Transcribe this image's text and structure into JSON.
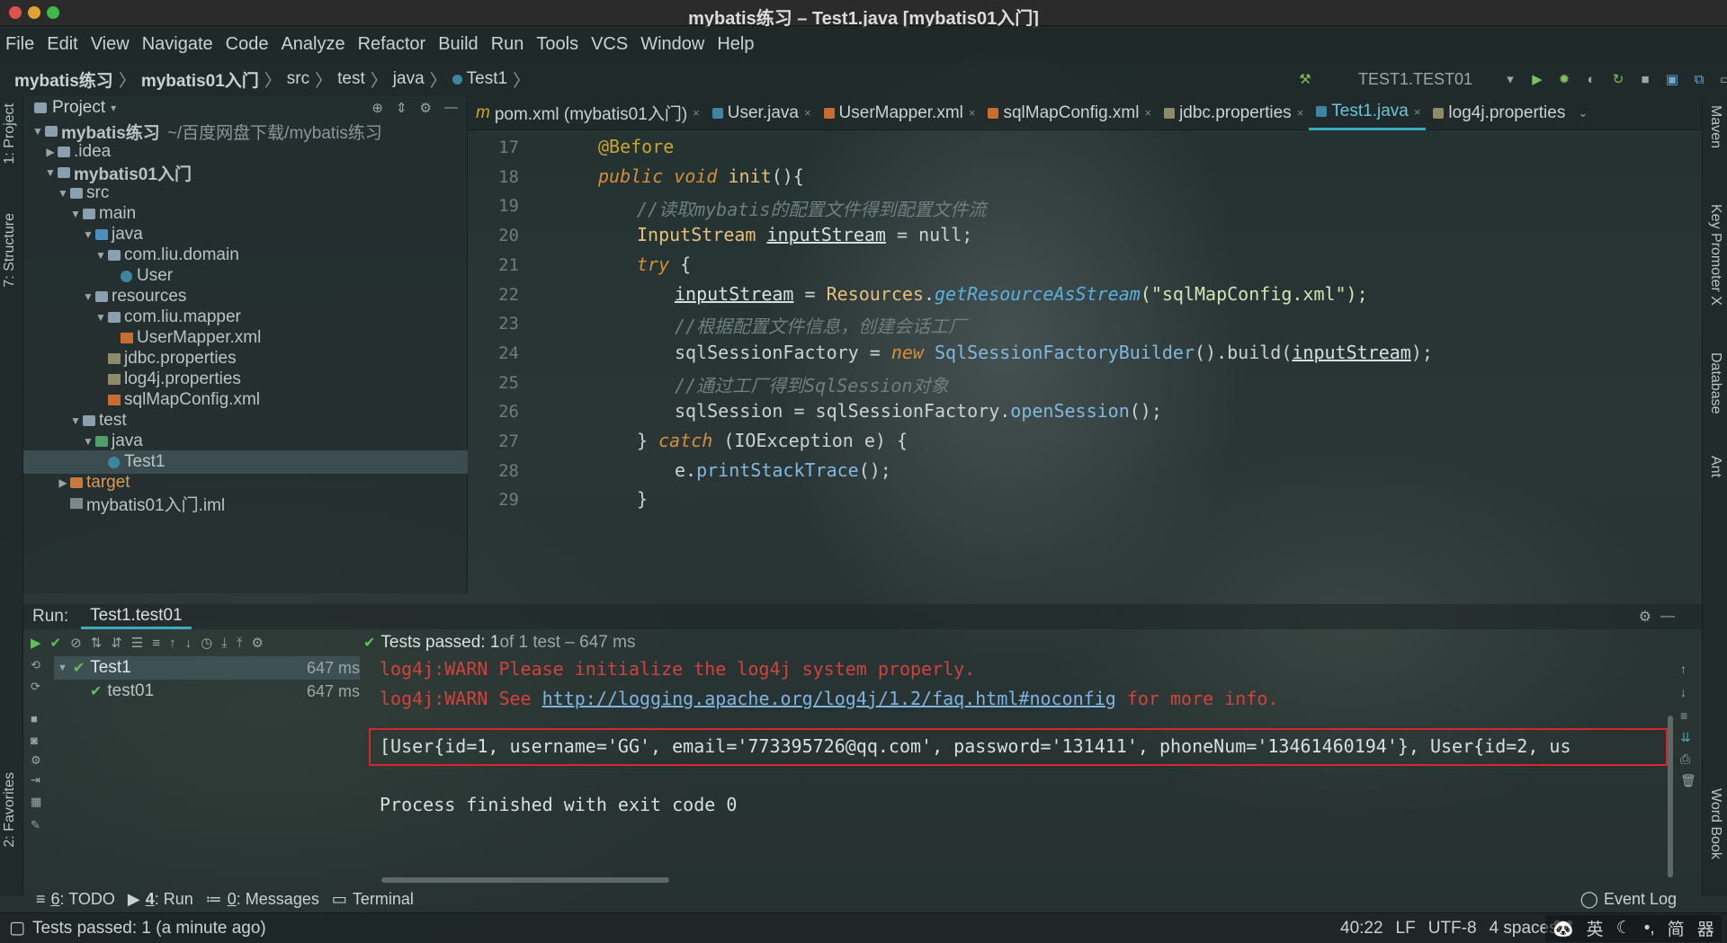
{
  "window": {
    "title": "mybatis练习 – Test1.java [mybatis01入门]"
  },
  "menu": [
    "File",
    "Edit",
    "View",
    "Navigate",
    "Code",
    "Analyze",
    "Refactor",
    "Build",
    "Run",
    "Tools",
    "VCS",
    "Window",
    "Help"
  ],
  "breadcrumb": [
    "mybatis练习",
    "mybatis01入门",
    "src",
    "test",
    "java",
    "Test1"
  ],
  "run_config": {
    "name": "TEST1.TEST01"
  },
  "left_strip": {
    "project_tab": "1: Project",
    "structure_tab": "7: Structure",
    "favorites_tab": "2: Favorites"
  },
  "right_strip": {
    "maven": "Maven",
    "key_promoter": "Key Promoter X",
    "database": "Database",
    "ant": "Ant",
    "word_book": "Word Book"
  },
  "project": {
    "header": "Project",
    "tree": [
      {
        "label": "mybatis练习",
        "suffix": "~/百度网盘下载/mybatis练习",
        "depth": 0,
        "arrow": "▼",
        "icon": "module"
      },
      {
        "label": ".idea",
        "depth": 1,
        "arrow": "▶",
        "icon": "folder"
      },
      {
        "label": "mybatis01入门",
        "depth": 1,
        "arrow": "▼",
        "icon": "module"
      },
      {
        "label": "src",
        "depth": 2,
        "arrow": "▼",
        "icon": "folder"
      },
      {
        "label": "main",
        "depth": 3,
        "arrow": "▼",
        "icon": "folder"
      },
      {
        "label": "java",
        "depth": 4,
        "arrow": "▼",
        "icon": "folder-blue"
      },
      {
        "label": "com.liu.domain",
        "depth": 5,
        "arrow": "▼",
        "icon": "package"
      },
      {
        "label": "User",
        "depth": 6,
        "arrow": "",
        "icon": "class"
      },
      {
        "label": "resources",
        "depth": 4,
        "arrow": "▼",
        "icon": "folder"
      },
      {
        "label": "com.liu.mapper",
        "depth": 5,
        "arrow": "▼",
        "icon": "package"
      },
      {
        "label": "UserMapper.xml",
        "depth": 6,
        "arrow": "",
        "icon": "xml"
      },
      {
        "label": "jdbc.properties",
        "depth": 5,
        "arrow": "",
        "icon": "properties"
      },
      {
        "label": "log4j.properties",
        "depth": 5,
        "arrow": "",
        "icon": "properties"
      },
      {
        "label": "sqlMapConfig.xml",
        "depth": 5,
        "arrow": "",
        "icon": "xml"
      },
      {
        "label": "test",
        "depth": 3,
        "arrow": "▼",
        "icon": "folder"
      },
      {
        "label": "java",
        "depth": 4,
        "arrow": "▼",
        "icon": "folder-green"
      },
      {
        "label": "Test1",
        "depth": 5,
        "arrow": "",
        "icon": "class",
        "selected": true
      },
      {
        "label": "target",
        "depth": 2,
        "arrow": "▶",
        "icon": "folder-orange"
      },
      {
        "label": "mybatis01入门.iml",
        "depth": 2,
        "arrow": "",
        "icon": "iml"
      }
    ]
  },
  "editor": {
    "tabs": [
      {
        "label": "pom.xml (mybatis01入门)",
        "icon": "maven"
      },
      {
        "label": "User.java",
        "icon": "class"
      },
      {
        "label": "UserMapper.xml",
        "icon": "xml"
      },
      {
        "label": "sqlMapConfig.xml",
        "icon": "xml"
      },
      {
        "label": "jdbc.properties",
        "icon": "properties"
      },
      {
        "label": "Test1.java",
        "icon": "class",
        "active": true
      },
      {
        "label": "log4j.properties",
        "icon": "properties"
      }
    ],
    "line_numbers": [
      "17",
      "18",
      "19",
      "20",
      "21",
      "22",
      "23",
      "24",
      "25",
      "26",
      "27",
      "28",
      "29"
    ],
    "code": {
      "l17": "@Before",
      "l18_kw1": "public",
      "l18_kw2": "void",
      "l18_name": "init",
      "l18_rest": "(){",
      "l19": "//读取mybatis的配置文件得到配置文件流",
      "l20_type": "InputStream",
      "l20_var": "inputStream",
      "l20_rest": " = null;",
      "l21_kw": "try",
      "l21_rest": " {",
      "l22_var": "inputStream",
      "l22_eq": " = ",
      "l22_cls": "Resources",
      "l22_dot": ".",
      "l22_mth": "getResourceAsStream",
      "l22_str": "(\"sqlMapConfig.xml\");",
      "l23": "//根据配置文件信息，创建会话工厂",
      "l24_a": "sqlSessionFactory = ",
      "l24_kw": "new",
      "l24_cls": " SqlSessionFactoryBuilder",
      "l24_b": "().build(",
      "l24_var": "inputStream",
      "l24_c": ");",
      "l25": "//通过工厂得到SqlSession对象",
      "l26_a": "sqlSession = sqlSessionFactory.",
      "l26_call": "openSession",
      "l26_b": "();",
      "l27_a": "} ",
      "l27_kw": "catch",
      "l27_b": " (IOException e) {",
      "l28_a": "e.",
      "l28_call": "printStackTrace",
      "l28_b": "();",
      "l29": "}"
    }
  },
  "run": {
    "label": "Run:",
    "tab": "Test1.test01",
    "status": "Tests passed: 1 of 1 test – 647 ms",
    "status_bold": "Tests passed: 1",
    "status_rest": " of 1 test – 647 ms",
    "tests": [
      {
        "name": "Test1",
        "time": "647 ms",
        "depth": 0
      },
      {
        "name": "test01",
        "time": "647 ms",
        "depth": 1
      }
    ],
    "console": {
      "warn1": "log4j:WARN Please initialize the log4j system properly.",
      "warn2_pre": "log4j:WARN See ",
      "warn2_link": "http://logging.apache.org/log4j/1.2/faq.html#noconfig",
      "warn2_post": " for more info.",
      "result": "[User{id=1, username='GG', email='773395726@qq.com', password='131411', phoneNum='13461460194'}, User{id=2, us",
      "exit": "Process finished with exit code 0"
    }
  },
  "bottom_tools": [
    {
      "num": "6",
      "label": ": TODO"
    },
    {
      "num": "4",
      "label": ": Run"
    },
    {
      "num": "0",
      "label": ": Messages"
    },
    {
      "num": "",
      "label": "Terminal"
    }
  ],
  "event_log": "Event Log",
  "statusbar": {
    "message": "Tests passed: 1 (a minute ago)",
    "position": "40:22",
    "line_sep": "LF",
    "encoding": "UTF-8",
    "indent": "4 spaces",
    "ime": [
      "英",
      "简",
      "器"
    ]
  },
  "colors": {
    "accent": "#3fa9bd",
    "highlight_box": "#d9262a",
    "warn_text": "#d2423a",
    "pass_green": "#5fbf5a"
  }
}
